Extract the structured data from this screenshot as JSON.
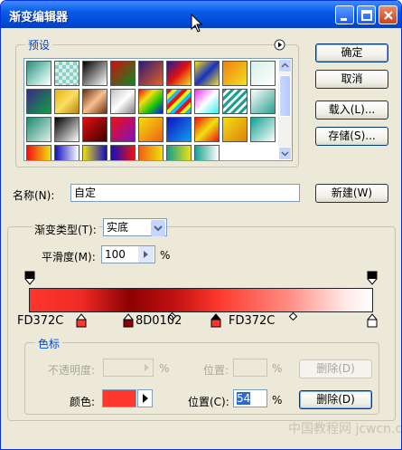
{
  "window": {
    "title": "渐变编辑器"
  },
  "buttons": {
    "ok": "确定",
    "cancel": "取消",
    "load": "载入(L)...",
    "save": "存储(S)...",
    "new": "新建(W)",
    "delete_opacity": "删除(D)",
    "delete_color": "删除(D)"
  },
  "presets": {
    "label": "预设"
  },
  "name": {
    "label": "名称(N):",
    "value": "自定"
  },
  "gradient": {
    "section_label": "",
    "type_label": "渐变类型(T):",
    "type_value": "实底",
    "smooth_label": "平滑度(M):",
    "smooth_value": "100",
    "smooth_unit": "%",
    "stop_labels": [
      "FD372C",
      "8D0102",
      "FD372C"
    ]
  },
  "color_stops": {
    "group_label": "色标",
    "opacity_label": "不透明度:",
    "opacity_unit": "%",
    "opacity_location_label": "位置:",
    "opacity_location_unit": "%",
    "color_label": "颜色:",
    "color_value": "#fd372c",
    "location_label": "位置(C):",
    "location_value": "54",
    "location_unit": "%"
  },
  "watermark": "中国教程网 jcwcn.com"
}
